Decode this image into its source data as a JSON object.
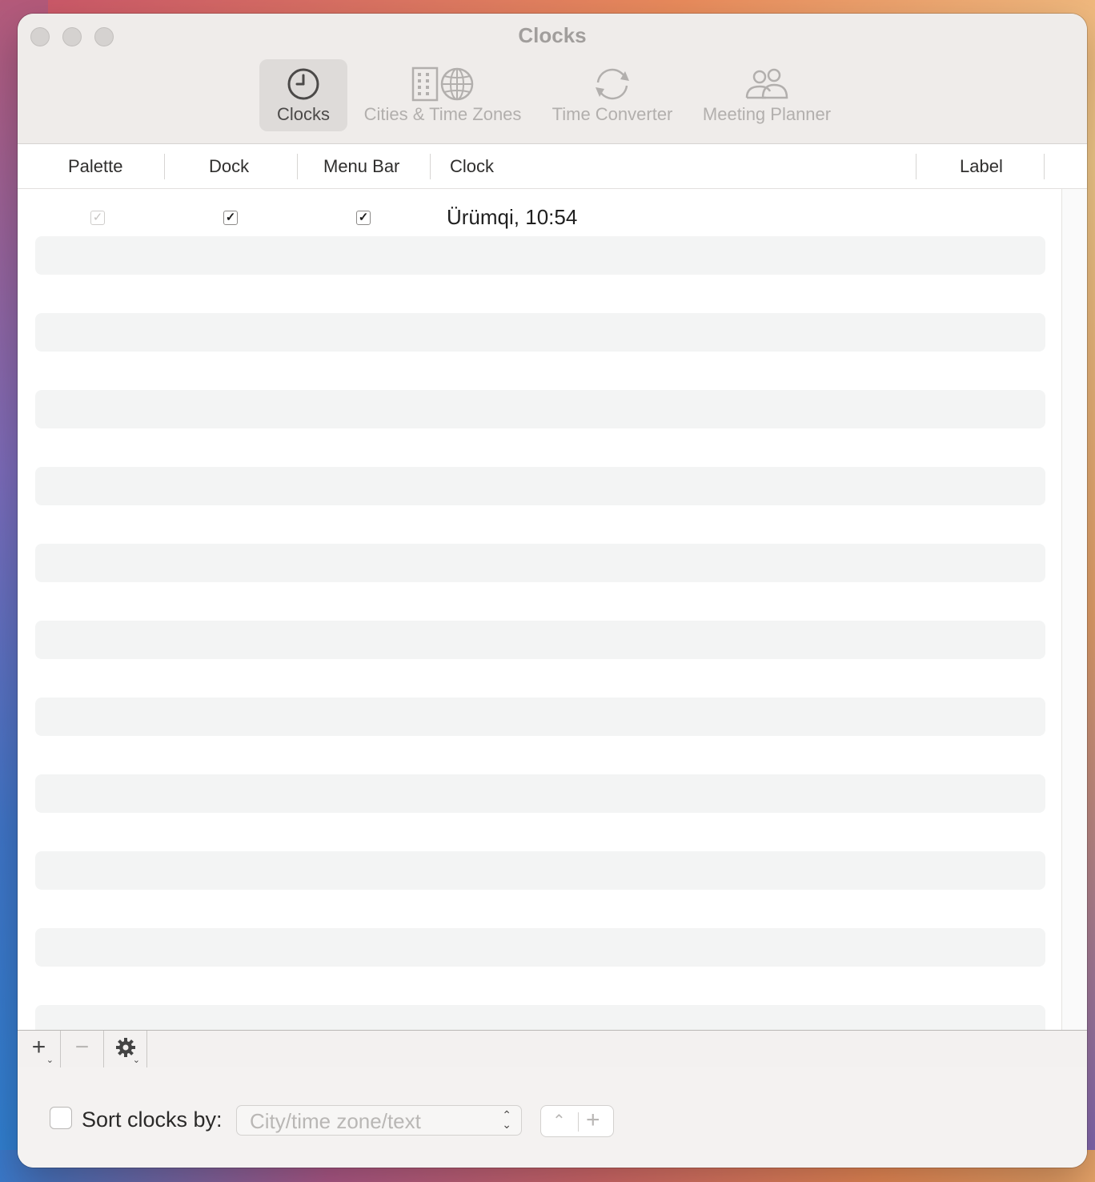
{
  "window": {
    "title": "Clocks"
  },
  "toolbar": {
    "items": [
      {
        "label": "Clocks",
        "icon": "clock-icon",
        "selected": true
      },
      {
        "label": "Cities & Time Zones",
        "icon": "building-globe-icon",
        "selected": false
      },
      {
        "label": "Time Converter",
        "icon": "refresh-arrows-icon",
        "selected": false
      },
      {
        "label": "Meeting Planner",
        "icon": "people-icon",
        "selected": false
      }
    ]
  },
  "table": {
    "columns": [
      "Palette",
      "Dock",
      "Menu Bar",
      "Clock",
      "Label"
    ],
    "rows": [
      {
        "palette": true,
        "dock": true,
        "menu_bar": true,
        "clock": "Ürümqi, 10:54",
        "label": ""
      }
    ]
  },
  "bottom_bar": {
    "add": "+",
    "remove": "−",
    "gear_icon": "gear-icon"
  },
  "footer": {
    "sort_label": "Sort clocks by:",
    "sort_checked": false,
    "sort_placeholder": "City/time zone/text",
    "stepper_up": "⌃",
    "stepper_plus": "+"
  },
  "colors": {
    "window_bg": "#f4f2f1",
    "selected_tab_bg": "#dedbd9",
    "row_stripe": "#f3f4f4"
  }
}
